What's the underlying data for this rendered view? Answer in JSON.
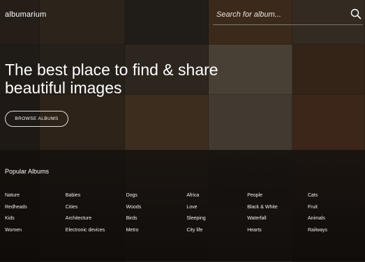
{
  "header": {
    "logo": "albumarium",
    "search_placeholder": "Search for album..."
  },
  "hero": {
    "title_line1": "The best place to find & share",
    "title_line2": "beautiful images",
    "button_label": "BROWSE ALBUMS"
  },
  "popular": {
    "title": "Popular Albums",
    "albums": [
      "Nature",
      "Babies",
      "Dogs",
      "Africa",
      "People",
      "Cats",
      "Redheads",
      "Cities",
      "Woods",
      "Love",
      "Black & White",
      "Fruit",
      "Kids",
      "Architecture",
      "Birds",
      "Sleeping",
      "Waterfall",
      "Animals",
      "Women",
      "Electronic devices",
      "Metro",
      "City life",
      "Hearts",
      "Railways"
    ]
  },
  "background_colors": [
    "#3a2f26",
    "#4a3c2e",
    "#2f2a24",
    "#6a4a30",
    "#5a4a3c",
    "#2e2924",
    "#3c342c",
    "#4c4036",
    "#8a7a66",
    "#5c3a24",
    "#2a2520",
    "#4e3a26",
    "#6e5034",
    "#7a6c5c",
    "#6a4228",
    "#1e1a16",
    "#2c2620",
    "#3a3026",
    "#2e2a24",
    "#3a2c22",
    "#1c1814",
    "#2a241e",
    "#34302a",
    "#3c3630",
    "#2a241e"
  ]
}
